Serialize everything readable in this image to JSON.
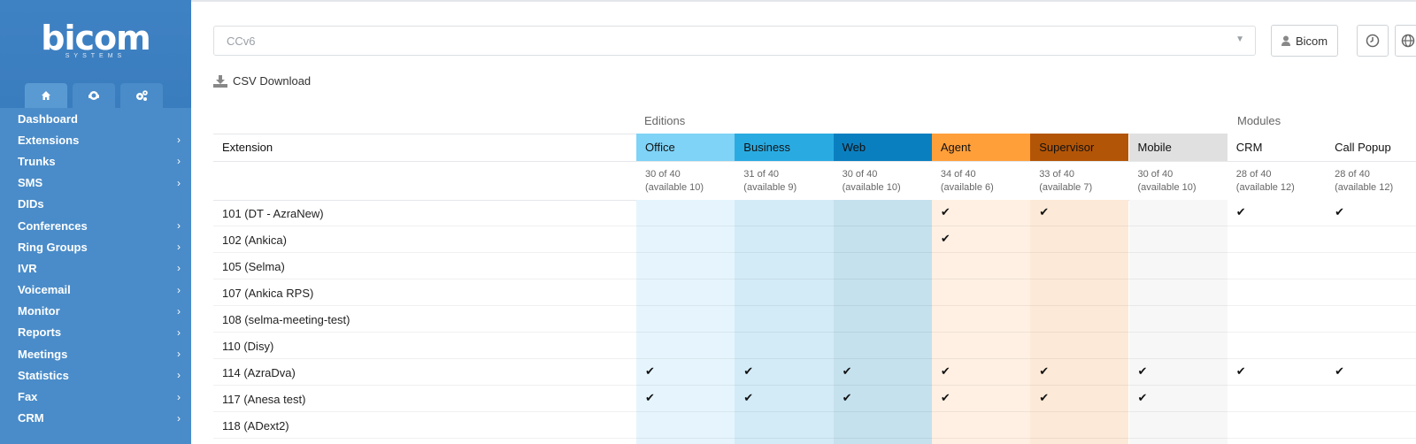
{
  "sidebar": {
    "logo": "bicom",
    "logo_sub": "SYSTEMS",
    "tabs": [
      {
        "icon": "home-icon"
      },
      {
        "icon": "headset-icon"
      },
      {
        "icon": "gears-icon"
      }
    ],
    "items": [
      {
        "label": "Dashboard",
        "chevron": ""
      },
      {
        "label": "Extensions",
        "chevron": "›"
      },
      {
        "label": "Trunks",
        "chevron": "›"
      },
      {
        "label": "SMS",
        "chevron": "›"
      },
      {
        "label": "DIDs",
        "chevron": ""
      },
      {
        "label": "Conferences",
        "chevron": "›"
      },
      {
        "label": "Ring Groups",
        "chevron": "›"
      },
      {
        "label": "IVR",
        "chevron": "›"
      },
      {
        "label": "Voicemail",
        "chevron": "›"
      },
      {
        "label": "Monitor",
        "chevron": "›"
      },
      {
        "label": "Reports",
        "chevron": "›"
      },
      {
        "label": "Meetings",
        "chevron": "›"
      },
      {
        "label": "Statistics",
        "chevron": "›"
      },
      {
        "label": "Fax",
        "chevron": "›"
      },
      {
        "label": "CRM",
        "chevron": "›"
      }
    ]
  },
  "header": {
    "tenant_select": "CCv6",
    "user_button": "Bicom"
  },
  "csv_download": "CSV Download",
  "table": {
    "group_editions": "Editions",
    "group_modules": "Modules",
    "extension_header": "Extension",
    "columns": [
      {
        "label": "Office",
        "count": "30 of 40",
        "available": "(available 10)",
        "header_bg": "#7ed3f7",
        "cell_bg": "#e6f5fd"
      },
      {
        "label": "Business",
        "count": "31 of 40",
        "available": "(available 9)",
        "header_bg": "#29abe2",
        "cell_bg": "#d3ebf7"
      },
      {
        "label": "Web",
        "count": "30 of 40",
        "available": "(available 10)",
        "header_bg": "#0a7fc0",
        "cell_bg": "#c5e1ee"
      },
      {
        "label": "Agent",
        "count": "34 of 40",
        "available": "(available 6)",
        "header_bg": "#ff9f3a",
        "cell_bg": "#fff0e3"
      },
      {
        "label": "Supervisor",
        "count": "33 of 40",
        "available": "(available 7)",
        "header_bg": "#b35506",
        "cell_bg": "#fde9d7"
      },
      {
        "label": "Mobile",
        "count": "30 of 40",
        "available": "(available 10)",
        "header_bg": "#e0e0e0",
        "cell_bg": "#f7f7f7"
      },
      {
        "label": "CRM",
        "count": "28 of 40",
        "available": "(available 12)",
        "header_bg": "#ffffff",
        "cell_bg": "#ffffff"
      },
      {
        "label": "Call Popup",
        "count": "28 of 40",
        "available": "(available 12)",
        "header_bg": "#ffffff",
        "cell_bg": "#ffffff"
      }
    ],
    "rows": [
      {
        "extension": "101 (DT - AzraNew)",
        "checks": [
          false,
          false,
          false,
          true,
          true,
          false,
          true,
          true
        ]
      },
      {
        "extension": "102 (Ankica)",
        "checks": [
          false,
          false,
          false,
          true,
          false,
          false,
          false,
          false
        ]
      },
      {
        "extension": "105 (Selma)",
        "checks": [
          false,
          false,
          false,
          false,
          false,
          false,
          false,
          false
        ]
      },
      {
        "extension": "107 (Ankica RPS)",
        "checks": [
          false,
          false,
          false,
          false,
          false,
          false,
          false,
          false
        ]
      },
      {
        "extension": "108 (selma-meeting-test)",
        "checks": [
          false,
          false,
          false,
          false,
          false,
          false,
          false,
          false
        ]
      },
      {
        "extension": "110 (Disy)",
        "checks": [
          false,
          false,
          false,
          false,
          false,
          false,
          false,
          false
        ]
      },
      {
        "extension": "114 (AzraDva)",
        "checks": [
          true,
          true,
          true,
          true,
          true,
          true,
          true,
          true
        ]
      },
      {
        "extension": "117 (Anesa test)",
        "checks": [
          true,
          true,
          true,
          true,
          true,
          true,
          false,
          false
        ]
      },
      {
        "extension": "118 (ADext2)",
        "checks": [
          false,
          false,
          false,
          false,
          false,
          false,
          false,
          false
        ]
      }
    ],
    "check_glyph": "✔"
  }
}
